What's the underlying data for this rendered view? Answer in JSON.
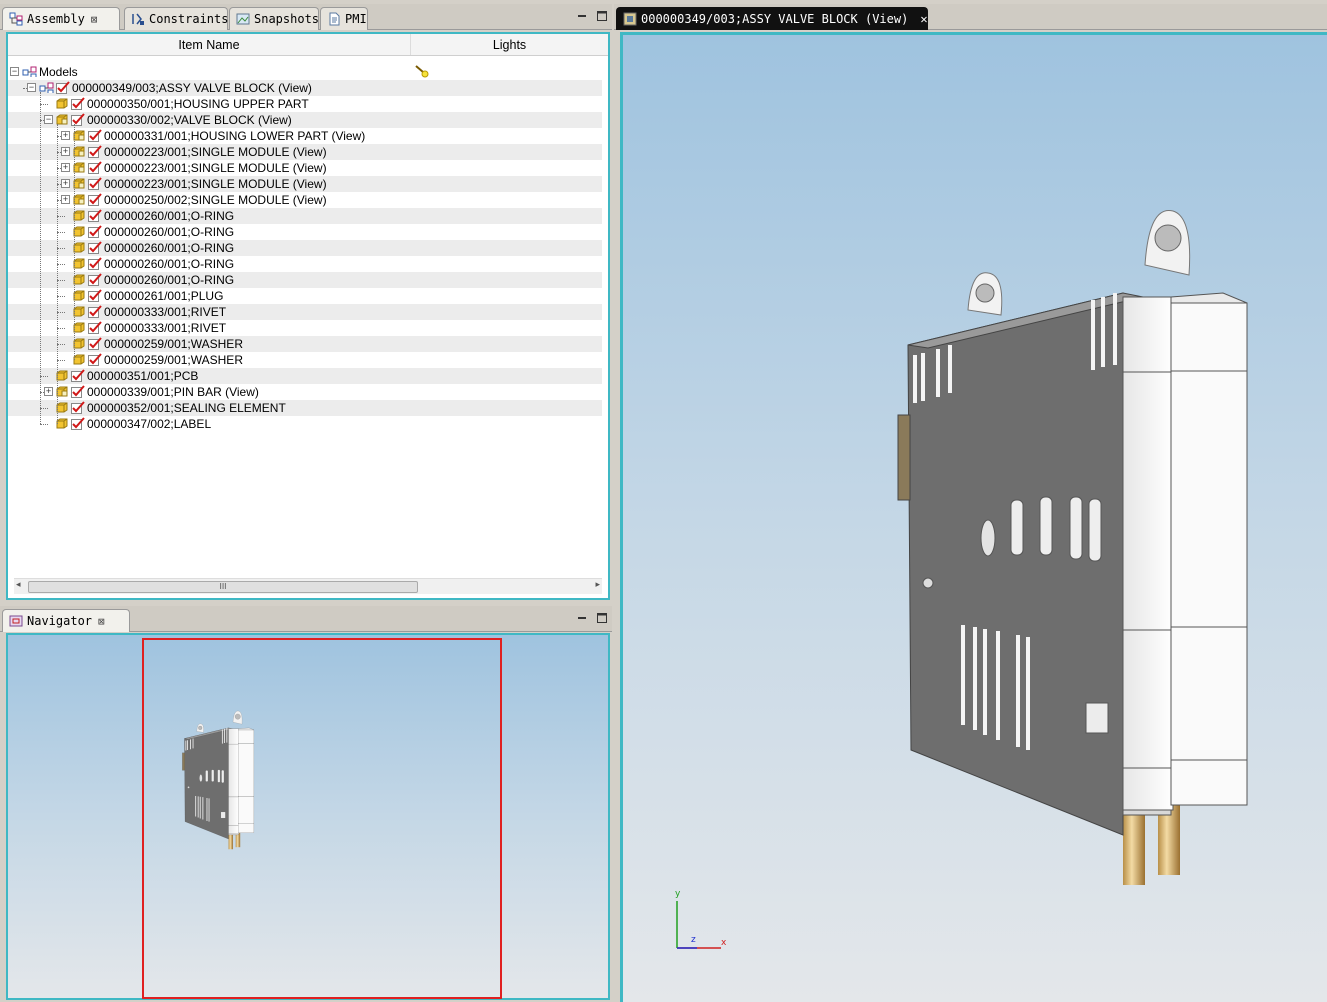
{
  "assembly_panel": {
    "tabs": [
      {
        "label": "Assembly",
        "icon": "assembly-icon",
        "active": true,
        "closable": true
      },
      {
        "label": "Constraints",
        "icon": "constraints-icon",
        "active": false
      },
      {
        "label": "Snapshots",
        "icon": "snapshots-icon",
        "active": false
      },
      {
        "label": "PMI",
        "icon": "pmi-icon",
        "active": false
      }
    ],
    "columns": {
      "item_name": "Item Name",
      "lights": "Lights"
    },
    "tree": [
      {
        "label": "Models",
        "depth": 0,
        "kind": "root",
        "expander": "minus"
      },
      {
        "label": "000000349/003;ASSY VALVE BLOCK (View)",
        "depth": 1,
        "kind": "assy",
        "expander": "minus"
      },
      {
        "label": "000000350/001;HOUSING UPPER PART",
        "depth": 2,
        "kind": "part"
      },
      {
        "label": "000000330/002;VALVE BLOCK (View)",
        "depth": 2,
        "kind": "subassy",
        "expander": "minus"
      },
      {
        "label": "000000331/001;HOUSING LOWER PART (View)",
        "depth": 3,
        "kind": "subassy",
        "expander": "plus"
      },
      {
        "label": "000000223/001;SINGLE MODULE (View)",
        "depth": 3,
        "kind": "subassy",
        "expander": "plus"
      },
      {
        "label": "000000223/001;SINGLE MODULE (View)",
        "depth": 3,
        "kind": "subassy",
        "expander": "plus"
      },
      {
        "label": "000000223/001;SINGLE MODULE (View)",
        "depth": 3,
        "kind": "subassy",
        "expander": "plus"
      },
      {
        "label": "000000250/002;SINGLE MODULE (View)",
        "depth": 3,
        "kind": "subassy",
        "expander": "plus"
      },
      {
        "label": "000000260/001;O-RING",
        "depth": 3,
        "kind": "part"
      },
      {
        "label": "000000260/001;O-RING",
        "depth": 3,
        "kind": "part"
      },
      {
        "label": "000000260/001;O-RING",
        "depth": 3,
        "kind": "part"
      },
      {
        "label": "000000260/001;O-RING",
        "depth": 3,
        "kind": "part"
      },
      {
        "label": "000000260/001;O-RING",
        "depth": 3,
        "kind": "part"
      },
      {
        "label": "000000261/001;PLUG",
        "depth": 3,
        "kind": "part"
      },
      {
        "label": "000000333/001;RIVET",
        "depth": 3,
        "kind": "part"
      },
      {
        "label": "000000333/001;RIVET",
        "depth": 3,
        "kind": "part"
      },
      {
        "label": "000000259/001;WASHER",
        "depth": 3,
        "kind": "part"
      },
      {
        "label": "000000259/001;WASHER",
        "depth": 3,
        "kind": "part"
      },
      {
        "label": "000000351/001;PCB",
        "depth": 2,
        "kind": "part"
      },
      {
        "label": "000000339/001;PIN BAR (View)",
        "depth": 2,
        "kind": "subassy",
        "expander": "plus"
      },
      {
        "label": "000000352/001;SEALING ELEMENT",
        "depth": 2,
        "kind": "part"
      },
      {
        "label": "000000347/002;LABEL",
        "depth": 2,
        "kind": "part"
      }
    ],
    "scroll_grip": "III"
  },
  "navigator_panel": {
    "tab_label": "Navigator",
    "icon": "navigator-icon"
  },
  "viewer": {
    "tab_label": "000000349/003;ASSY VALVE BLOCK (View)",
    "icon": "model-view-icon",
    "axes": {
      "y": "y",
      "z": "z",
      "x": "x"
    }
  },
  "colors": {
    "panel_border": "#3fb8c4",
    "navigator_frame": "#e02020",
    "check_red": "#d01818",
    "cube_yellow": "#f2c431"
  }
}
